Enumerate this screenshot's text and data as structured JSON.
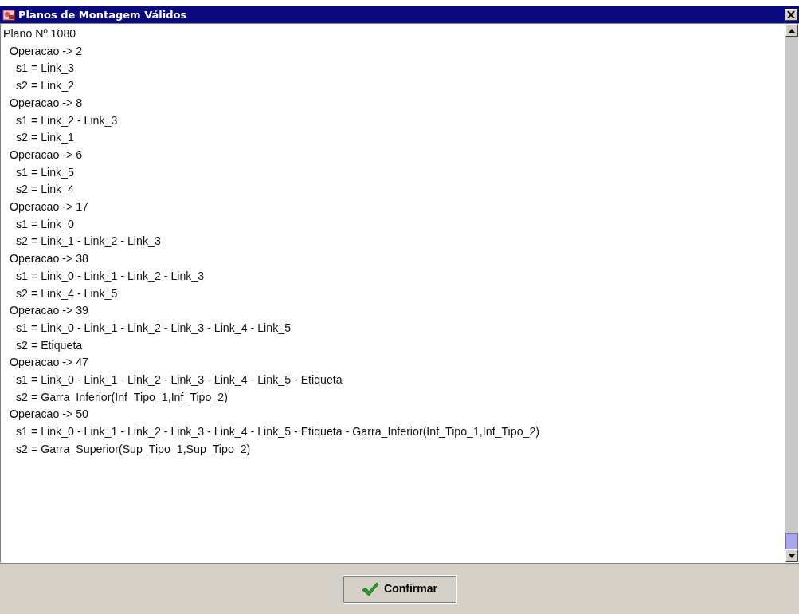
{
  "window": {
    "title": "Planos de Montagem Válidos"
  },
  "plan": {
    "label": "Plano Nº 1080",
    "children": [
      {
        "label": "Operacao -> 2",
        "children": [
          {
            "label": "s1 = Link_3"
          },
          {
            "label": "s2 = Link_2"
          }
        ]
      },
      {
        "label": "Operacao -> 8",
        "children": [
          {
            "label": "s1 = Link_2 - Link_3"
          },
          {
            "label": "s2 = Link_1"
          }
        ]
      },
      {
        "label": "Operacao -> 6",
        "children": [
          {
            "label": "s1 = Link_5"
          },
          {
            "label": "s2 = Link_4"
          }
        ]
      },
      {
        "label": "Operacao -> 17",
        "children": [
          {
            "label": "s1 = Link_0"
          },
          {
            "label": "s2 = Link_1 - Link_2 - Link_3"
          }
        ]
      },
      {
        "label": "Operacao -> 38",
        "children": [
          {
            "label": "s1 = Link_0 - Link_1 - Link_2 - Link_3"
          },
          {
            "label": "s2 = Link_4 - Link_5"
          }
        ]
      },
      {
        "label": "Operacao -> 39",
        "children": [
          {
            "label": "s1 = Link_0 - Link_1 - Link_2 - Link_3 - Link_4 - Link_5"
          },
          {
            "label": "s2 = Etiqueta"
          }
        ]
      },
      {
        "label": "Operacao -> 47",
        "children": [
          {
            "label": "s1 = Link_0 - Link_1 - Link_2 - Link_3 - Link_4 - Link_5 - Etiqueta"
          },
          {
            "label": "s2 = Garra_Inferior(Inf_Tipo_1,Inf_Tipo_2)"
          }
        ]
      },
      {
        "label": "Operacao -> 50",
        "children": [
          {
            "label": "s1 = Link_0 - Link_1 - Link_2 - Link_3 - Link_4 - Link_5 - Etiqueta - Garra_Inferior(Inf_Tipo_1,Inf_Tipo_2)"
          },
          {
            "label": "s2 = Garra_Superior(Sup_Tipo_1,Sup_Tipo_2)"
          }
        ]
      }
    ]
  },
  "buttons": [
    {
      "label": "Confirmar"
    }
  ]
}
